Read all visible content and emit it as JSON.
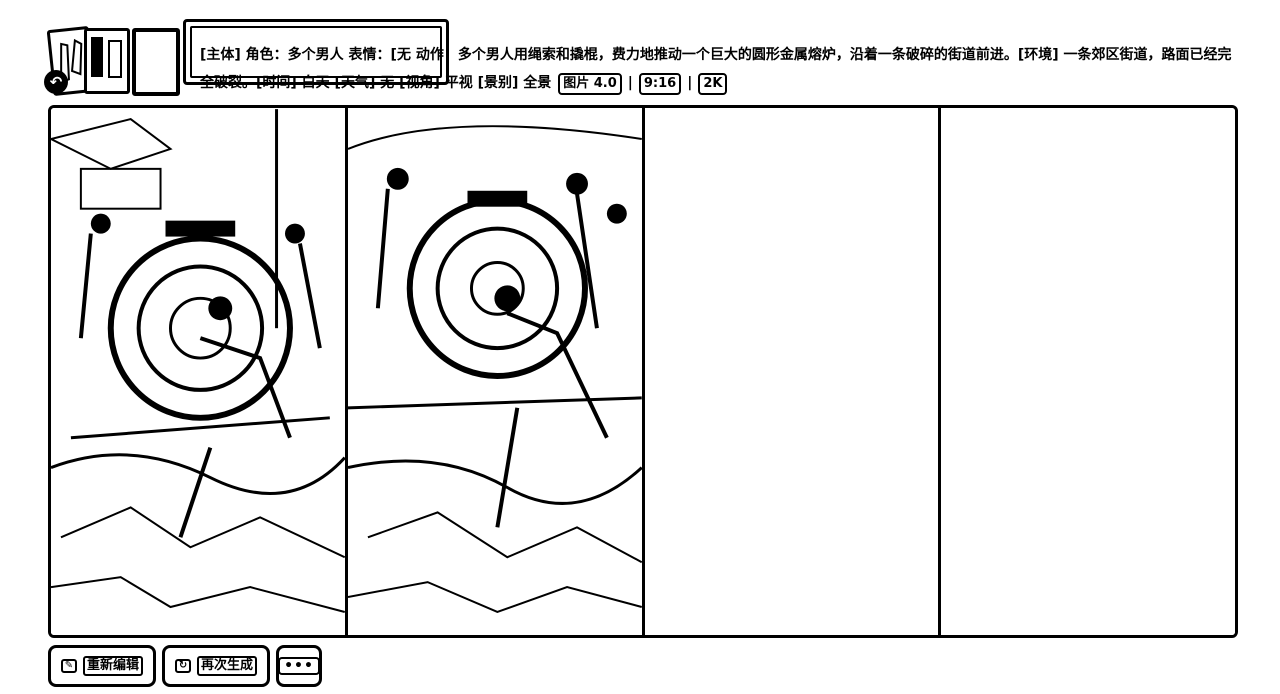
{
  "header": {
    "undo_glyph": "↶",
    "prompt_parts": [
      "[主体] 角色：多个男人 表情：",
      "[无",
      "动作：多个男人用绳索和撬棍，费力地推动一个巨大的圆形金属熔炉，沿着一条破碎的街道前进。[环境] 一条郊区街道，路面已经完全破裂。[时间] 白天 [天气] 无 [视角] 平视 [景别] 全景",
      "图片 4.0",
      "9:16",
      "2K"
    ]
  },
  "gallery": {
    "images": [
      {
        "alt": "men pushing a giant round metal furnace along a cracked suburban street - image 1"
      },
      {
        "alt": "men pushing a giant round metal furnace along a cracked suburban street - image 2"
      },
      {
        "alt": ""
      },
      {
        "alt": ""
      }
    ]
  },
  "actions": {
    "reedit_label": "重新编辑",
    "regenerate_label": "再次生成",
    "more_label": "•••"
  }
}
